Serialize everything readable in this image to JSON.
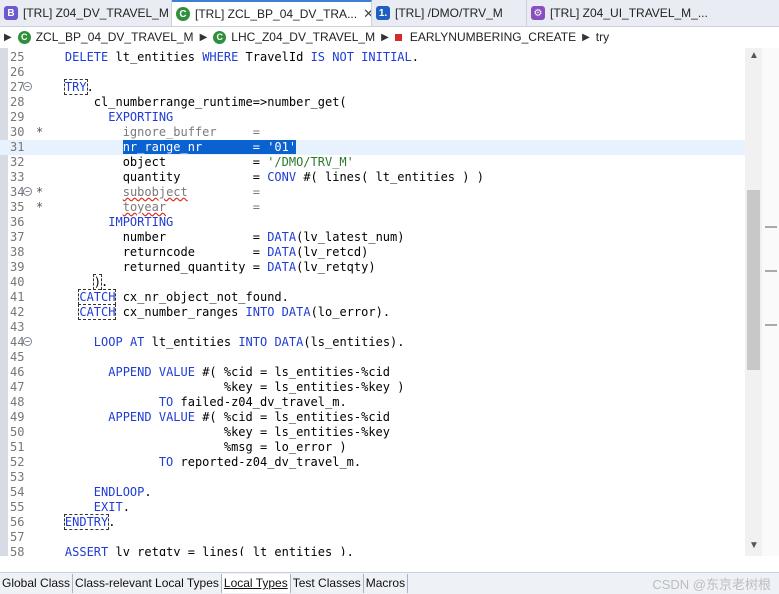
{
  "tabs": [
    {
      "icon_text": "B",
      "icon_color": "#6a5acd",
      "label": "[TRL] Z04_DV_TRAVEL_M",
      "active": false
    },
    {
      "icon_text": "C",
      "icon_color": "#2f8f3a",
      "label": "[TRL] ZCL_BP_04_DV_TRA...",
      "active": true,
      "close": "✕"
    },
    {
      "icon_text": "1.",
      "icon_color": "#1f5fbf",
      "label": "[TRL] /DMO/TRV_M",
      "active": false
    },
    {
      "icon_text": "⚙",
      "icon_color": "#8a4fbf",
      "label": "[TRL] Z04_UI_TRAVEL_M_...",
      "active": false
    }
  ],
  "breadcrumb": {
    "item1": "ZCL_BP_04_DV_TRAVEL_M",
    "item2": "LHC_Z04_DV_TRAVEL_M",
    "item3": "EARLYNUMBERING_CREATE",
    "item4": "try"
  },
  "editor": {
    "current_line": 31,
    "lines": [
      {
        "n": "25",
        "text": "    DELETE lt_entities WHERE TravelId IS NOT INITIAL."
      },
      {
        "n": "26",
        "text": ""
      },
      {
        "n": "27",
        "text": "    TRY.",
        "fold": true
      },
      {
        "n": "28",
        "text": "        cl_numberrange_runtime=>number_get("
      },
      {
        "n": "29",
        "text": "          EXPORTING"
      },
      {
        "n": "30",
        "text": "*           ignore_buffer     =",
        "comment": true
      },
      {
        "n": "31",
        "text": "            nr_range_nr       = '01'"
      },
      {
        "n": "32",
        "text": "            object            = '/DMO/TRV_M'"
      },
      {
        "n": "33",
        "text": "            quantity          = CONV #( lines( lt_entities ) )"
      },
      {
        "n": "34",
        "text": "*           subobject         =",
        "comment": true,
        "fold": true
      },
      {
        "n": "35",
        "text": "*           toyear            =",
        "comment": true
      },
      {
        "n": "36",
        "text": "          IMPORTING"
      },
      {
        "n": "37",
        "text": "            number            = DATA(lv_latest_num)"
      },
      {
        "n": "38",
        "text": "            returncode        = DATA(lv_retcd)"
      },
      {
        "n": "39",
        "text": "            returned_quantity = DATA(lv_retqty)"
      },
      {
        "n": "40",
        "text": "        )."
      },
      {
        "n": "41",
        "text": "      CATCH cx_nr_object_not_found."
      },
      {
        "n": "42",
        "text": "      CATCH cx_number_ranges INTO DATA(lo_error)."
      },
      {
        "n": "43",
        "text": ""
      },
      {
        "n": "44",
        "text": "        LOOP AT lt_entities INTO DATA(ls_entities).",
        "fold": true
      },
      {
        "n": "45",
        "text": ""
      },
      {
        "n": "46",
        "text": "          APPEND VALUE #( %cid = ls_entities-%cid"
      },
      {
        "n": "47",
        "text": "                          %key = ls_entities-%key )"
      },
      {
        "n": "48",
        "text": "                 TO failed-z04_dv_travel_m."
      },
      {
        "n": "49",
        "text": "          APPEND VALUE #( %cid = ls_entities-%cid"
      },
      {
        "n": "50",
        "text": "                          %key = ls_entities-%key"
      },
      {
        "n": "51",
        "text": "                          %msg = lo_error )"
      },
      {
        "n": "52",
        "text": "                 TO reported-z04_dv_travel_m."
      },
      {
        "n": "53",
        "text": ""
      },
      {
        "n": "54",
        "text": "        ENDLOOP."
      },
      {
        "n": "55",
        "text": "        EXIT."
      },
      {
        "n": "56",
        "text": "    ENDTRY."
      },
      {
        "n": "57",
        "text": ""
      },
      {
        "n": "58",
        "text": "    ASSERT lv_retqty = lines( lt_entities )."
      }
    ]
  },
  "scrollbar": {
    "up": "▲",
    "down": "▼"
  },
  "bottom_tabs": [
    {
      "label": "Global Class",
      "active": false
    },
    {
      "label": "Class-relevant Local Types",
      "active": false
    },
    {
      "label": "Local Types",
      "active": true
    },
    {
      "label": "Test Classes",
      "active": false
    },
    {
      "label": "Macros",
      "active": false
    }
  ],
  "watermark": "CSDN @东京老树根"
}
